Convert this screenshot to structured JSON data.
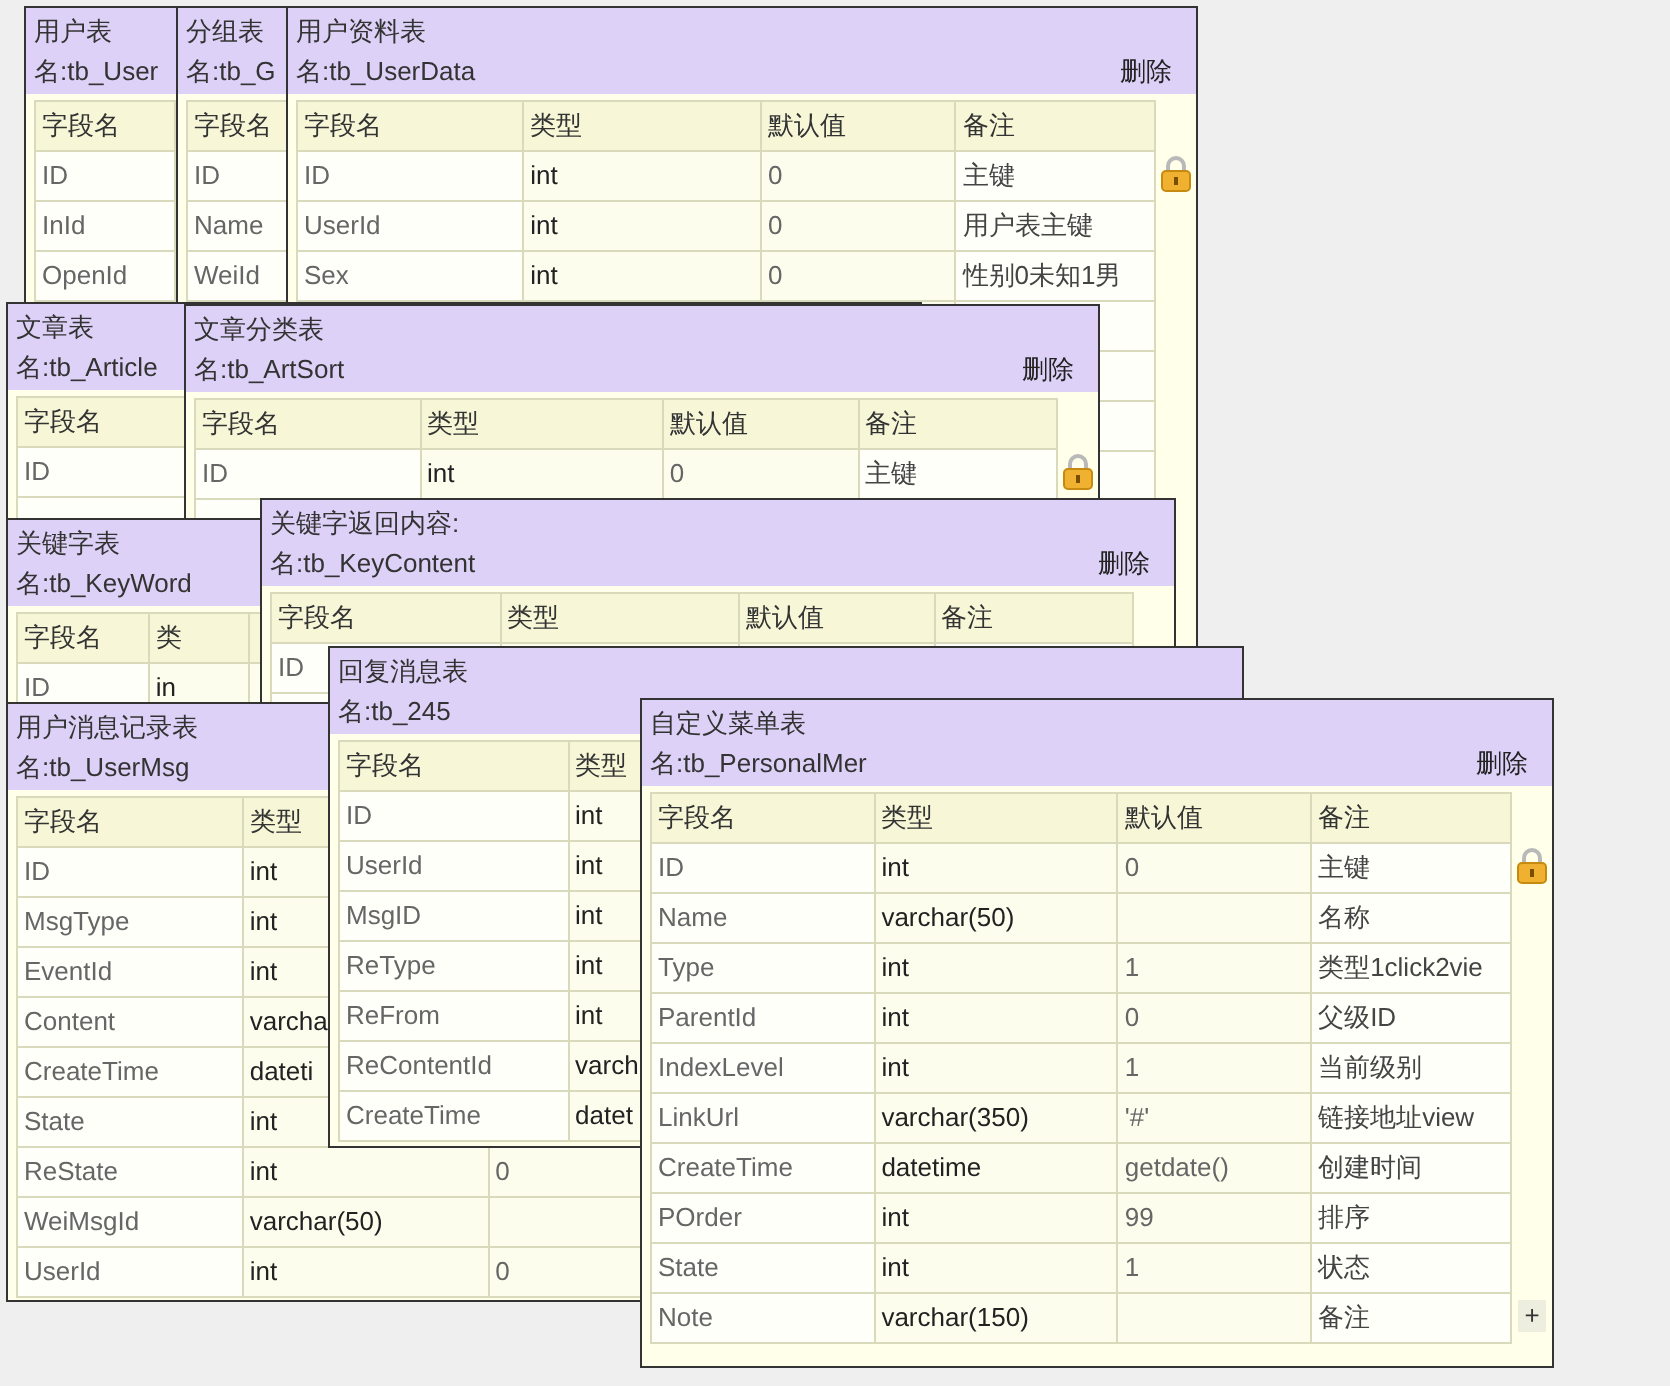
{
  "windows": [
    {
      "title": "用户表",
      "name": "名:tb_User",
      "columns": [
        "字段名"
      ],
      "rows": [
        [
          "ID"
        ],
        [
          "InId"
        ],
        [
          "OpenId"
        ]
      ]
    },
    {
      "title": "分组表",
      "name": "名:tb_G",
      "columns": [
        "字段名"
      ],
      "rows": [
        [
          "ID"
        ],
        [
          "Name"
        ],
        [
          "WeiId"
        ]
      ]
    },
    {
      "title": "用户资料表",
      "name": "名:tb_UserData",
      "delete": "删除",
      "locked": true,
      "columns": [
        "字段名",
        "类型",
        "默认值",
        "备注"
      ],
      "rows": [
        [
          "ID",
          "int",
          "0",
          "主键"
        ],
        [
          "UserId",
          "int",
          "0",
          "用户表主键"
        ],
        [
          "Sex",
          "int",
          "0",
          "性别0未知1男"
        ]
      ]
    },
    {
      "title": "文章表",
      "name": "名:tb_Article",
      "columns": [
        "字段名"
      ],
      "rows": [
        [
          "ID"
        ]
      ]
    },
    {
      "title": "文章分类表",
      "name": "名:tb_ArtSort",
      "delete": "删除",
      "locked": true,
      "columns": [
        "字段名",
        "类型",
        "默认值",
        "备注"
      ],
      "rows": [
        [
          "ID",
          "int",
          "0",
          "主键"
        ]
      ]
    },
    {
      "title": "关键字表",
      "name": "名:tb_KeyWord",
      "columns": [
        "字段名",
        "类"
      ],
      "rows": [
        [
          "ID",
          "in"
        ]
      ]
    },
    {
      "title": "关键字返回内容:",
      "name": "名:tb_KeyContent",
      "delete": "删除",
      "columns": [
        "字段名",
        "类型",
        "默认值",
        "备注"
      ],
      "rows": [
        [
          "ID"
        ]
      ]
    },
    {
      "title": "用户消息记录表",
      "name": "名:tb_UserMsg",
      "columns": [
        "字段名",
        "类型"
      ],
      "rows": [
        [
          "ID",
          "int"
        ],
        [
          "MsgType",
          "int"
        ],
        [
          "EventId",
          "int"
        ],
        [
          "Content",
          "varcha"
        ],
        [
          "CreateTime",
          "dateti"
        ],
        [
          "State",
          "int"
        ],
        [
          "ReState",
          "int",
          "0"
        ],
        [
          "WeiMsgId",
          "varchar(50)"
        ],
        [
          "UserId",
          "int",
          "0"
        ]
      ]
    },
    {
      "title": "回复消息表",
      "name": "名:tb_245",
      "columns": [
        "字段名",
        "类型"
      ],
      "rows": [
        [
          "ID",
          "int"
        ],
        [
          "UserId",
          "int"
        ],
        [
          "MsgID",
          "int"
        ],
        [
          "ReType",
          "int"
        ],
        [
          "ReFrom",
          "int"
        ],
        [
          "ReContentId",
          "varch"
        ],
        [
          "CreateTime",
          "datet"
        ]
      ]
    },
    {
      "title": "自定义菜单表",
      "name": "名:tb_PersonalMer",
      "delete": "删除",
      "locked": true,
      "add_button": "+",
      "columns": [
        "字段名",
        "类型",
        "默认值",
        "备注"
      ],
      "rows": [
        [
          "ID",
          "int",
          "0",
          "主键"
        ],
        [
          "Name",
          "varchar(50)",
          "",
          "名称"
        ],
        [
          "Type",
          "int",
          "1",
          "类型1click2vie"
        ],
        [
          "ParentId",
          "int",
          "0",
          "父级ID"
        ],
        [
          "IndexLevel",
          "int",
          "1",
          "当前级别"
        ],
        [
          "LinkUrl",
          "varchar(350)",
          "'#'",
          "链接地址view"
        ],
        [
          "CreateTime",
          "datetime",
          "getdate()",
          "创建时间"
        ],
        [
          "POrder",
          "int",
          "99",
          "排序"
        ],
        [
          "State",
          "int",
          "1",
          "状态"
        ],
        [
          "Note",
          "varchar(150)",
          "",
          "备注"
        ]
      ]
    }
  ]
}
